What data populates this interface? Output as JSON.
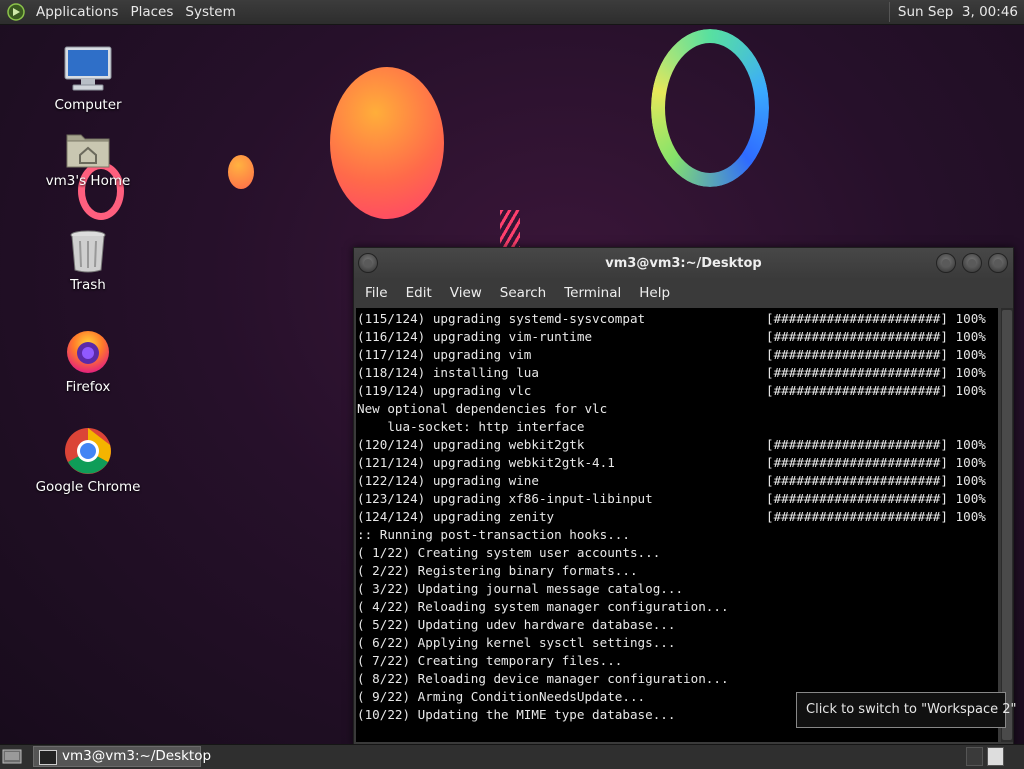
{
  "top_panel": {
    "menus": [
      "Applications",
      "Places",
      "System"
    ],
    "clock": "Sun Sep  3, 00:46"
  },
  "desktop_icons": [
    {
      "label": "Computer",
      "icon": "computer-icon"
    },
    {
      "label": "vm3's Home",
      "icon": "home-folder-icon"
    },
    {
      "label": "Trash",
      "icon": "trash-icon"
    },
    {
      "label": "Firefox",
      "icon": "firefox-icon"
    },
    {
      "label": "Google Chrome",
      "icon": "chrome-icon"
    }
  ],
  "terminal": {
    "title": "vm3@vm3:~/Desktop",
    "menu": [
      "File",
      "Edit",
      "Search",
      "Terminal",
      "Help"
    ],
    "menu_view": "View",
    "lines": [
      {
        "text": "(115/124) upgrading systemd-sysvcompat",
        "progress": "[######################] 100%"
      },
      {
        "text": "(116/124) upgrading vim-runtime",
        "progress": "[######################] 100%"
      },
      {
        "text": "(117/124) upgrading vim",
        "progress": "[######################] 100%"
      },
      {
        "text": "(118/124) installing lua",
        "progress": "[######################] 100%"
      },
      {
        "text": "(119/124) upgrading vlc",
        "progress": "[######################] 100%"
      },
      {
        "text": "New optional dependencies for vlc",
        "progress": ""
      },
      {
        "text": "    lua-socket: http interface",
        "progress": ""
      },
      {
        "text": "(120/124) upgrading webkit2gtk",
        "progress": "[######################] 100%"
      },
      {
        "text": "(121/124) upgrading webkit2gtk-4.1",
        "progress": "[######################] 100%"
      },
      {
        "text": "(122/124) upgrading wine",
        "progress": "[######################] 100%"
      },
      {
        "text": "(123/124) upgrading xf86-input-libinput",
        "progress": "[######################] 100%"
      },
      {
        "text": "(124/124) upgrading zenity",
        "progress": "[######################] 100%"
      },
      {
        "text": ":: Running post-transaction hooks...",
        "progress": ""
      },
      {
        "text": "( 1/22) Creating system user accounts...",
        "progress": ""
      },
      {
        "text": "( 2/22) Registering binary formats...",
        "progress": ""
      },
      {
        "text": "( 3/22) Updating journal message catalog...",
        "progress": ""
      },
      {
        "text": "( 4/22) Reloading system manager configuration...",
        "progress": ""
      },
      {
        "text": "( 5/22) Updating udev hardware database...",
        "progress": ""
      },
      {
        "text": "( 6/22) Applying kernel sysctl settings...",
        "progress": ""
      },
      {
        "text": "( 7/22) Creating temporary files...",
        "progress": ""
      },
      {
        "text": "( 8/22) Reloading device manager configuration...",
        "progress": ""
      },
      {
        "text": "( 9/22) Arming ConditionNeedsUpdate...",
        "progress": ""
      },
      {
        "text": "(10/22) Updating the MIME type database...",
        "progress": ""
      }
    ]
  },
  "tooltip": "Click to switch to \"Workspace 2\"",
  "taskbar": {
    "task_label": "vm3@vm3:~/Desktop"
  }
}
